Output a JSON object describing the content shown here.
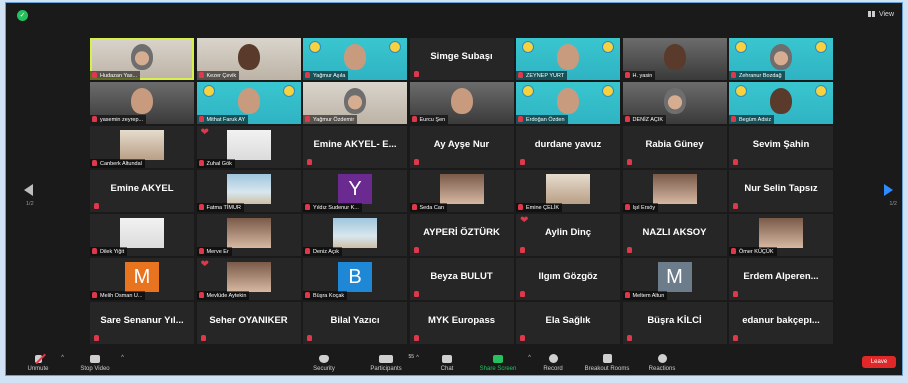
{
  "header": {
    "view_label": "View"
  },
  "pagination": {
    "left": "1/2",
    "right": "1/2"
  },
  "participants": [
    {
      "name": "Hudazan Yas...",
      "kind": "video",
      "style": "active"
    },
    {
      "name": "Kezer Çevik",
      "kind": "video",
      "style": "room"
    },
    {
      "name": "Yağmur Aşıla",
      "kind": "video",
      "style": "banner"
    },
    {
      "name": "Simge Subaşı",
      "kind": "name"
    },
    {
      "name": "ZEYNEP YURT",
      "kind": "video",
      "style": "banner"
    },
    {
      "name": "H. yasin",
      "kind": "video",
      "style": "photo"
    },
    {
      "name": "Zehranur Bozdağ",
      "kind": "video",
      "style": "banner"
    },
    {
      "name": "yasemin zeyrep...",
      "kind": "video",
      "style": "photo"
    },
    {
      "name": "Mithat Faruk AY",
      "kind": "video",
      "style": "banner"
    },
    {
      "name": "Yağmur Özdemir",
      "kind": "video",
      "style": "room"
    },
    {
      "name": "Eurcu Şen",
      "kind": "video",
      "style": "photo"
    },
    {
      "name": "Erdoğan Özden",
      "kind": "video",
      "style": "banner"
    },
    {
      "name": "DENİZ AÇIK",
      "kind": "video",
      "style": "photo"
    },
    {
      "name": "Begüm Adsiz",
      "kind": "video",
      "style": "banner"
    },
    {
      "name": "Canberk Altundal",
      "kind": "photo",
      "thumb": "beige"
    },
    {
      "name": "Zuhal Gök",
      "kind": "photo",
      "thumb": "white",
      "heart": true
    },
    {
      "name": "Emine AKYEL- E...",
      "kind": "name"
    },
    {
      "name": "Ay Ayşe Nur",
      "kind": "name"
    },
    {
      "name": "durdane yavuz",
      "kind": "name"
    },
    {
      "name": "Rabia Güney",
      "kind": "name"
    },
    {
      "name": "Sevim Şahin",
      "kind": "name"
    },
    {
      "name": "Emine AKYEL",
      "kind": "name"
    },
    {
      "name": "Fatma TİMUR",
      "kind": "photo",
      "thumb": "sea"
    },
    {
      "name": "Yıldız Sudenur K...",
      "kind": "avatar",
      "letter": "Y",
      "color": "#6b2a8f"
    },
    {
      "name": "Seda Can",
      "kind": "photo",
      "thumb": "warm"
    },
    {
      "name": "Emine ÇELİK",
      "kind": "photo",
      "thumb": "beige"
    },
    {
      "name": "Işıl Ersöy",
      "kind": "photo",
      "thumb": "warm"
    },
    {
      "name": "Nur Selin Tapsız",
      "kind": "name"
    },
    {
      "name": "Dilek Yiğit",
      "kind": "photo",
      "thumb": "white"
    },
    {
      "name": "Merve Er",
      "kind": "photo",
      "thumb": "warm"
    },
    {
      "name": "Deniz Açık",
      "kind": "photo",
      "thumb": "sea"
    },
    {
      "name": "AYPERİ ÖZTÜRK",
      "kind": "name"
    },
    {
      "name": "Aylin Dinç",
      "kind": "name",
      "heart": true
    },
    {
      "name": "NAZLI AKSOY",
      "kind": "name"
    },
    {
      "name": "Ömer KÜÇÜK",
      "kind": "photo",
      "thumb": "warm"
    },
    {
      "name": "Melih Osman U...",
      "kind": "avatar",
      "letter": "M",
      "color": "#e8741f"
    },
    {
      "name": "Mevlüde Aytekin",
      "kind": "photo",
      "thumb": "warm",
      "heart": true
    },
    {
      "name": "Büşra Koçak",
      "kind": "avatar",
      "letter": "B",
      "color": "#1e88d6"
    },
    {
      "name": "Beyza BULUT",
      "kind": "name"
    },
    {
      "name": "Ilgım Gözgöz",
      "kind": "name"
    },
    {
      "name": "Meltem Altun",
      "kind": "avatar",
      "letter": "M",
      "color": "#6d7c8a"
    },
    {
      "name": "Erdem Alperen...",
      "kind": "name"
    },
    {
      "name": "Sare Senanur Yıl...",
      "kind": "name"
    },
    {
      "name": "Seher OYANIKER",
      "kind": "name"
    },
    {
      "name": "Bilal Yazıcı",
      "kind": "name"
    },
    {
      "name": "MYK Europass",
      "kind": "name"
    },
    {
      "name": "Ela Sağlık",
      "kind": "name"
    },
    {
      "name": "Büşra KİLCİ",
      "kind": "name"
    },
    {
      "name": "edanur bakçepı...",
      "kind": "name"
    }
  ],
  "toolbar": {
    "unmute": "Unmute",
    "stop_video": "Stop Video",
    "security": "Security",
    "participants": "Participants",
    "participants_count": "55",
    "chat": "Chat",
    "share_screen": "Share Screen",
    "record": "Record",
    "breakout_rooms": "Breakout Rooms",
    "reactions": "Reactions",
    "leave": "Leave"
  },
  "colors": {
    "share_green": "#24c15e",
    "leave_red": "#e02828",
    "active_outline": "#d8f04a",
    "page_arrow": "#2d8cff"
  }
}
